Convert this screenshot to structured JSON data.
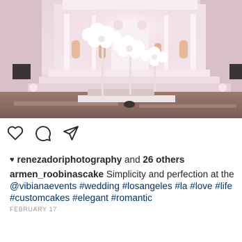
{
  "post": {
    "likes": {
      "icon": "filled-heart-icon",
      "username": "renezadoriphotography",
      "connector": " and ",
      "others": "26 others"
    },
    "caption": {
      "username": "armen_roobinascake",
      "text_1": " Simplicity and perfection at the ",
      "mention": "@vibianaevents",
      "hashtags": [
        "#wedding",
        "#losangeles",
        "#la",
        "#love",
        "#life",
        "#customcakes",
        "#elegant",
        "#romantic"
      ]
    },
    "date": "FEBRUARY 17",
    "actions": [
      {
        "icon": "heart-outline-icon"
      },
      {
        "icon": "comment-icon"
      },
      {
        "icon": "share-paper-plane-icon"
      }
    ],
    "colors": {
      "link": "#003569",
      "text": "#262626",
      "muted": "#999999"
    }
  }
}
